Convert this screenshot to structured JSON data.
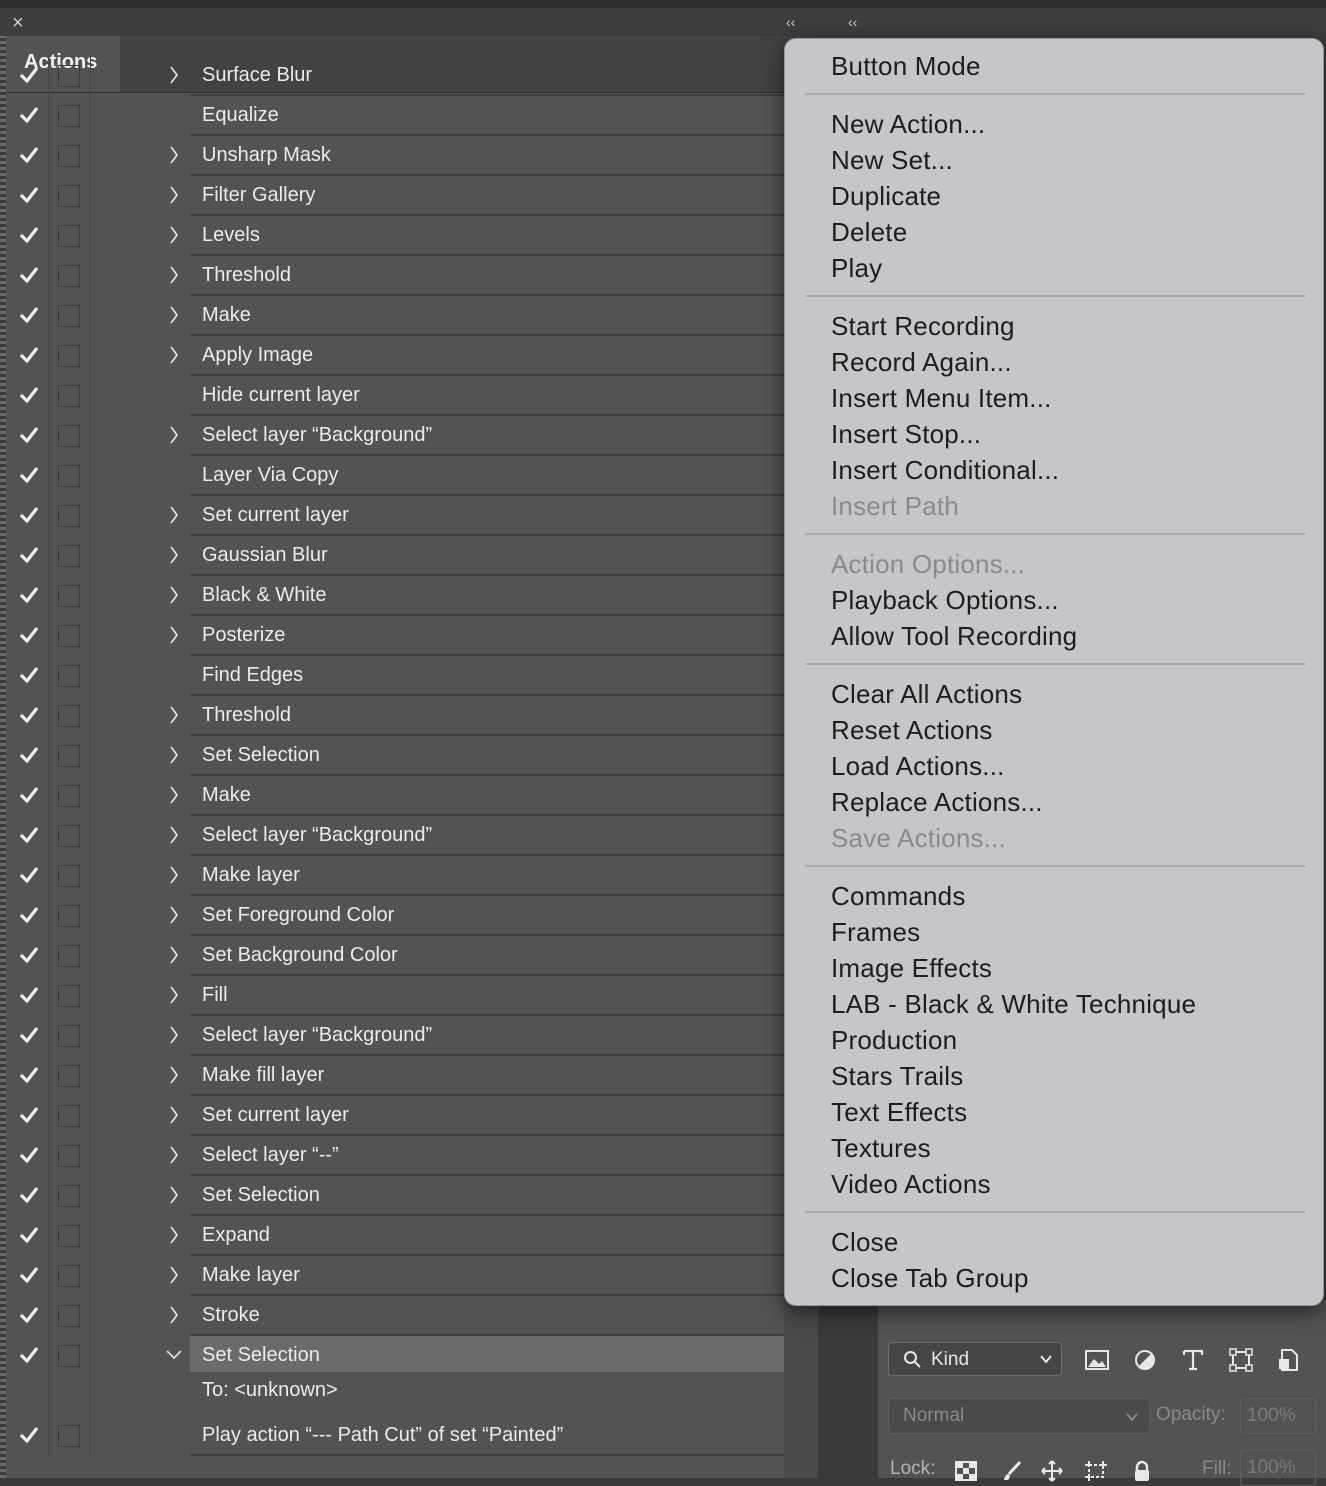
{
  "panel": {
    "close_glyph": "×",
    "collapse_glyph": "‹‹",
    "tab_label": "Actions"
  },
  "rows": [
    {
      "label": "Surface Blur",
      "checked": true,
      "expandable": true
    },
    {
      "label": "Equalize",
      "checked": true,
      "expandable": false
    },
    {
      "label": "Unsharp Mask",
      "checked": true,
      "expandable": true
    },
    {
      "label": "Filter Gallery",
      "checked": true,
      "expandable": true
    },
    {
      "label": "Levels",
      "checked": true,
      "expandable": true
    },
    {
      "label": "Threshold",
      "checked": true,
      "expandable": true
    },
    {
      "label": "Make",
      "checked": true,
      "expandable": true
    },
    {
      "label": "Apply Image",
      "checked": true,
      "expandable": true
    },
    {
      "label": "Hide current layer",
      "checked": true,
      "expandable": false
    },
    {
      "label": "Select layer “Background”",
      "checked": true,
      "expandable": true
    },
    {
      "label": "Layer Via Copy",
      "checked": true,
      "expandable": false
    },
    {
      "label": "Set current layer",
      "checked": true,
      "expandable": true
    },
    {
      "label": "Gaussian Blur",
      "checked": true,
      "expandable": true
    },
    {
      "label": "Black & White",
      "checked": true,
      "expandable": true
    },
    {
      "label": "Posterize",
      "checked": true,
      "expandable": true
    },
    {
      "label": "Find Edges",
      "checked": true,
      "expandable": false
    },
    {
      "label": "Threshold",
      "checked": true,
      "expandable": true
    },
    {
      "label": "Set Selection",
      "checked": true,
      "expandable": true
    },
    {
      "label": "Make",
      "checked": true,
      "expandable": true
    },
    {
      "label": "Select layer “Background”",
      "checked": true,
      "expandable": true
    },
    {
      "label": "Make layer",
      "checked": true,
      "expandable": true
    },
    {
      "label": "Set Foreground Color",
      "checked": true,
      "expandable": true
    },
    {
      "label": "Set Background Color",
      "checked": true,
      "expandable": true
    },
    {
      "label": "Fill",
      "checked": true,
      "expandable": true
    },
    {
      "label": "Select layer “Background”",
      "checked": true,
      "expandable": true
    },
    {
      "label": "Make fill layer",
      "checked": true,
      "expandable": true
    },
    {
      "label": "Set current layer",
      "checked": true,
      "expandable": true
    },
    {
      "label": "Select layer “--”",
      "checked": true,
      "expandable": true
    },
    {
      "label": "Set Selection",
      "checked": true,
      "expandable": true
    },
    {
      "label": "Expand",
      "checked": true,
      "expandable": true
    },
    {
      "label": "Make layer",
      "checked": true,
      "expandable": true
    },
    {
      "label": "Stroke",
      "checked": true,
      "expandable": true
    },
    {
      "label": "Set Selection",
      "checked": true,
      "expandable": true,
      "expanded": true,
      "selected": true
    },
    {
      "label": "To: <unknown>",
      "checked": false,
      "expandable": false,
      "detail": true
    },
    {
      "label": "Play action “--- Path Cut” of set “Painted”",
      "checked": true,
      "expandable": false
    }
  ],
  "menu": {
    "groups": [
      [
        {
          "label": "Button Mode",
          "disabled": false
        }
      ],
      [
        {
          "label": "New Action...",
          "disabled": false
        },
        {
          "label": "New Set...",
          "disabled": false
        },
        {
          "label": "Duplicate",
          "disabled": false
        },
        {
          "label": "Delete",
          "disabled": false
        },
        {
          "label": "Play",
          "disabled": false
        }
      ],
      [
        {
          "label": "Start Recording",
          "disabled": false
        },
        {
          "label": "Record Again...",
          "disabled": false
        },
        {
          "label": "Insert Menu Item...",
          "disabled": false
        },
        {
          "label": "Insert Stop...",
          "disabled": false
        },
        {
          "label": "Insert Conditional...",
          "disabled": false
        },
        {
          "label": "Insert Path",
          "disabled": true
        }
      ],
      [
        {
          "label": "Action Options...",
          "disabled": true
        },
        {
          "label": "Playback Options...",
          "disabled": false
        },
        {
          "label": "Allow Tool Recording",
          "disabled": false
        }
      ],
      [
        {
          "label": "Clear All Actions",
          "disabled": false
        },
        {
          "label": "Reset Actions",
          "disabled": false
        },
        {
          "label": "Load Actions...",
          "disabled": false
        },
        {
          "label": "Replace Actions...",
          "disabled": false
        },
        {
          "label": "Save Actions...",
          "disabled": true
        }
      ],
      [
        {
          "label": "Commands",
          "disabled": false
        },
        {
          "label": "Frames",
          "disabled": false
        },
        {
          "label": "Image Effects",
          "disabled": false
        },
        {
          "label": "LAB - Black & White Technique",
          "disabled": false
        },
        {
          "label": "Production",
          "disabled": false
        },
        {
          "label": "Stars Trails",
          "disabled": false
        },
        {
          "label": "Text Effects",
          "disabled": false
        },
        {
          "label": "Textures",
          "disabled": false
        },
        {
          "label": "Video Actions",
          "disabled": false
        }
      ],
      [
        {
          "label": "Close",
          "disabled": false
        },
        {
          "label": "Close Tab Group",
          "disabled": false
        }
      ]
    ]
  },
  "layers": {
    "filter_kind": "Kind",
    "blend_mode": "Normal",
    "opacity_label": "Opacity:",
    "opacity_value": "100%",
    "lock_label": "Lock:",
    "fill_label": "Fill:",
    "fill_value": "100%"
  },
  "colors": {
    "panel_bg": "#535353",
    "menu_bg": "#c6c6ca",
    "selected_row": "#6b6b6b"
  }
}
